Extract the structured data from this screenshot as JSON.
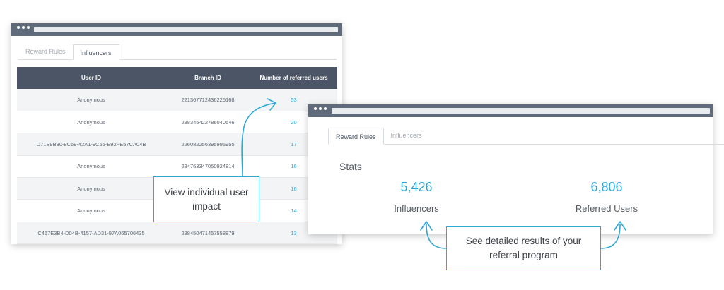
{
  "influencers_window": {
    "tabs": [
      {
        "label": "Reward Rules",
        "active": false
      },
      {
        "label": "Influencers",
        "active": true
      }
    ],
    "table": {
      "headers": [
        "User ID",
        "Branch ID",
        "Number of referred users"
      ],
      "rows": [
        {
          "user_id": "Anonymous",
          "branch_id": "221367712436225168",
          "referred": "53"
        },
        {
          "user_id": "Anonymous",
          "branch_id": "238345422786040546",
          "referred": "20"
        },
        {
          "user_id": "D71E9B30-8C69-42A1-9C55-E92FE57CA04B",
          "branch_id": "226082256395996955",
          "referred": "17"
        },
        {
          "user_id": "Anonymous",
          "branch_id": "234763347050924814",
          "referred": "16"
        },
        {
          "user_id": "Anonymous",
          "branch_id": "",
          "referred": "16"
        },
        {
          "user_id": "Anonymous",
          "branch_id": "",
          "referred": "14"
        },
        {
          "user_id": "C467E3B4-D04B-4157-AD31-97A065706435",
          "branch_id": "238450471457558879",
          "referred": "13"
        }
      ]
    }
  },
  "stats_window": {
    "tabs": [
      {
        "label": "Reward Rules",
        "active": true
      },
      {
        "label": "Influencers",
        "active": false
      }
    ],
    "title": "Stats",
    "influencers_value": "5,426",
    "influencers_label": "Influencers",
    "referred_value": "6,806",
    "referred_label": "Referred Users"
  },
  "callouts": {
    "individual": "View individual user impact",
    "program": "See detailed results of your referral program"
  },
  "colors": {
    "accent": "#2fa8d6",
    "titlebar": "#5f6b7b",
    "table_header": "#4b5565"
  }
}
